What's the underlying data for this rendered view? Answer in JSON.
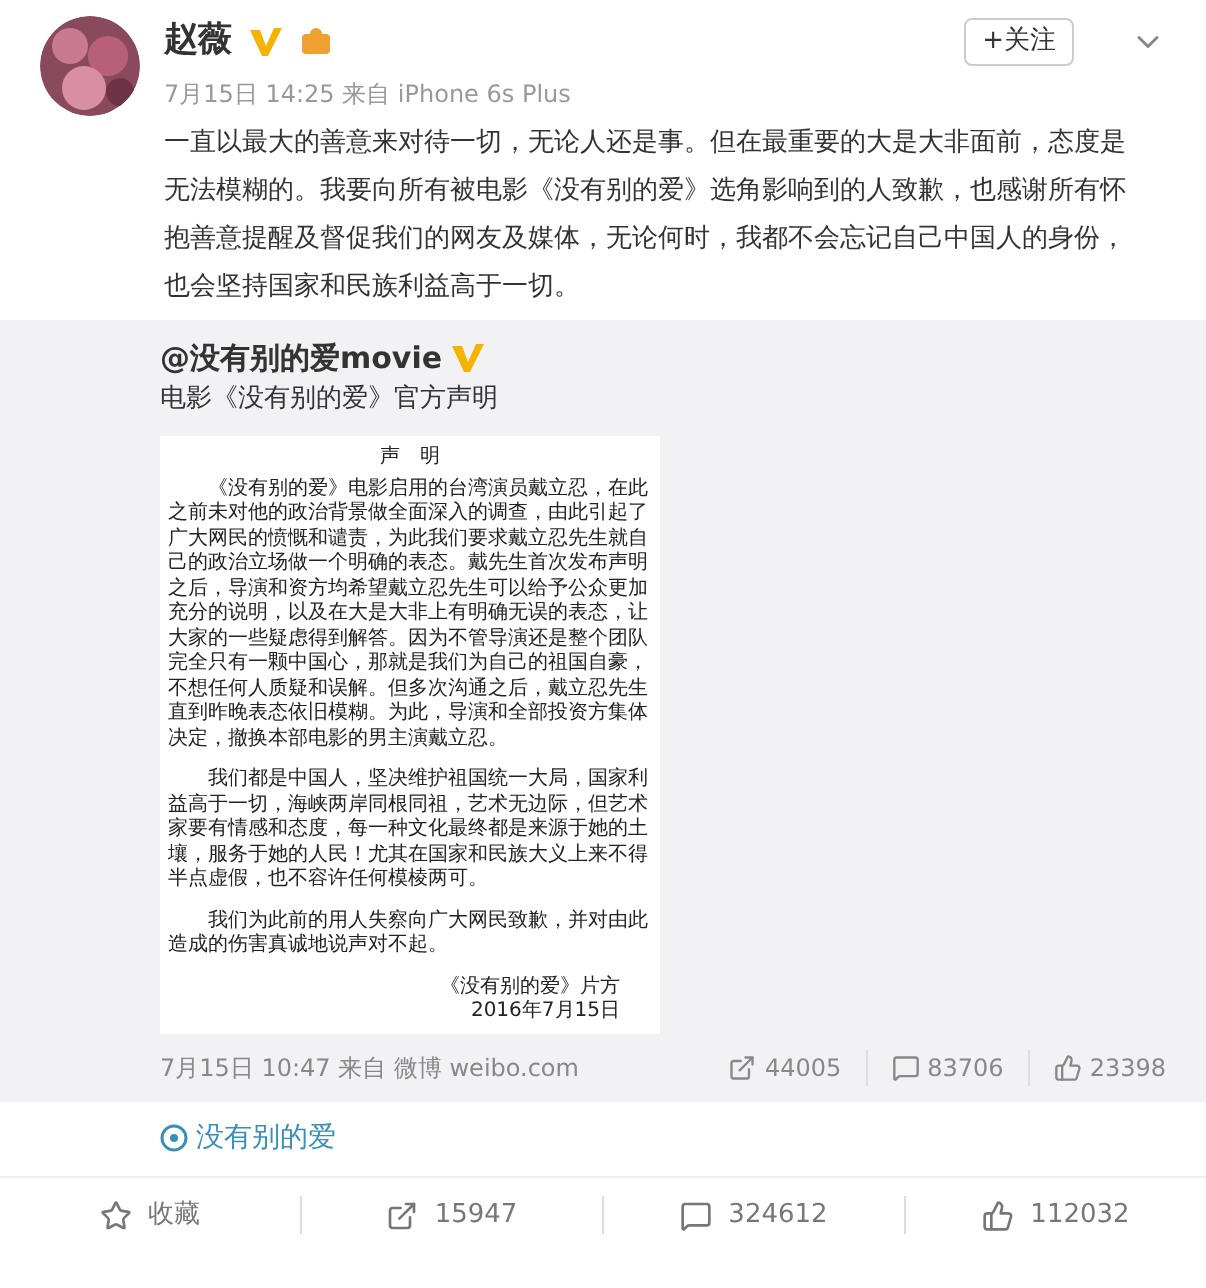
{
  "post": {
    "author": "赵薇",
    "verified": true,
    "time": "7月15日 14:25 来自 iPhone 6s Plus",
    "follow_button": "+关注",
    "text": "一直以最大的善意来对待一切，无论人还是事。但在最重要的大是大非面前，态度是无法模糊的。我要向所有被电影《没有别的爱》选角影响到的人致歉，也感谢所有怀抱善意提醒及督促我们的网友及媒体，无论何时，我都不会忘记自己中国人的身份，也会坚持国家和民族利益高于一切。"
  },
  "repost": {
    "author": "@没有别的爱movie",
    "verified": true,
    "text": "电影《没有别的爱》官方声明",
    "document": {
      "title": "声　明",
      "paragraphs": [
        "《没有别的爱》电影启用的台湾演员戴立忍，在此之前未对他的政治背景做全面深入的调查，由此引起了广大网民的愤慨和谴责，为此我们要求戴立忍先生就自己的政治立场做一个明确的表态。戴先生首次发布声明之后，导演和资方均希望戴立忍先生可以给予公众更加充分的说明，以及在大是大非上有明确无误的表态，让大家的一些疑虑得到解答。因为不管导演还是整个团队完全只有一颗中国心，那就是我们为自己的祖国自豪，不想任何人质疑和误解。但多次沟通之后，戴立忍先生直到昨晚表态依旧模糊。为此，导演和全部投资方集体决定，撤换本部电影的男主演戴立忍。",
        "我们都是中国人，坚决维护祖国统一大局，国家利益高于一切，海峡两岸同根同祖，艺术无边际，但艺术家要有情感和态度，每一种文化最终都是来源于她的土壤，服务于她的人民！尤其在国家和民族大义上来不得半点虚假，也不容许任何模棱两可。",
        "我们为此前的用人失察向广大网民致歉，并对由此造成的伤害真诚地说声对不起。"
      ],
      "signature": [
        "《没有别的爱》片方",
        "2016年7月15日"
      ]
    },
    "time": "7月15日 10:47 来自 微博 weibo.com",
    "reposts": "44005",
    "comments": "83706",
    "likes": "23398"
  },
  "topic": "没有别的爱",
  "actions": [
    {
      "kind": "favorite",
      "label": "收藏"
    },
    {
      "kind": "repost",
      "label": "15947"
    },
    {
      "kind": "comment",
      "label": "324612"
    },
    {
      "kind": "like",
      "label": "112032"
    }
  ]
}
